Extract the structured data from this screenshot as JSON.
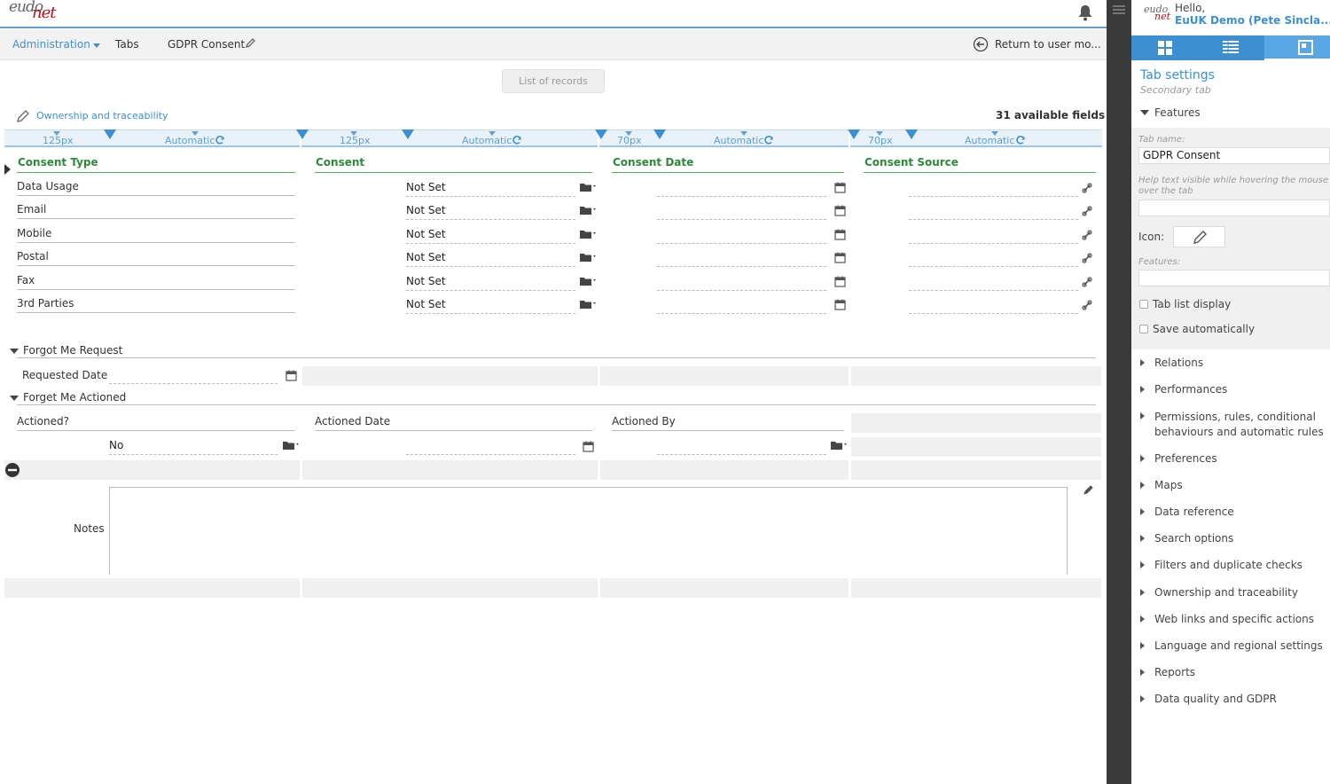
{
  "logo": {
    "line1": "eudo",
    "line2": "net"
  },
  "nav": {
    "administration": "Administration",
    "tabs": "Tabs",
    "tab_title": "GDPR Consent",
    "return_label": "Return to user mo..."
  },
  "toolbar": {
    "list_of_records": "List of records",
    "ownership_link": "Ownership and traceability",
    "available_fields": "31 available fields"
  },
  "ruler": [
    {
      "width_label": "125px",
      "mode_label": "Automatic"
    },
    {
      "width_label": "125px",
      "mode_label": "Automatic"
    },
    {
      "width_label": "70px",
      "mode_label": "Automatic"
    },
    {
      "width_label": "70px",
      "mode_label": "Automatic"
    }
  ],
  "consent_table": {
    "headers": [
      "Consent Type",
      "Consent",
      "Consent Date",
      "Consent Source"
    ],
    "rows": [
      {
        "type": "Data Usage",
        "consent": "Not Set"
      },
      {
        "type": "Email",
        "consent": "Not Set"
      },
      {
        "type": "Mobile",
        "consent": "Not Set"
      },
      {
        "type": "Postal",
        "consent": "Not Set"
      },
      {
        "type": "Fax",
        "consent": "Not Set"
      },
      {
        "type": "3rd Parties",
        "consent": "Not Set"
      }
    ]
  },
  "forgot_section": {
    "title": "Forgot Me Request",
    "requested_date_label": "Requested Date"
  },
  "actioned_section": {
    "title": "Forget Me Actioned",
    "actioned_label": "Actioned?",
    "actioned_value": "No",
    "actioned_date_label": "Actioned Date",
    "actioned_by_label": "Actioned By"
  },
  "notes": {
    "label": "Notes"
  },
  "user": {
    "greeting": "Hello,",
    "name": "EuUK Demo (Pete Sincla..."
  },
  "right_panel": {
    "title": "Tab settings",
    "subtitle": "Secondary tab",
    "features_header": "Features",
    "tab_name_label": "Tab name:",
    "tab_name_value": "GDPR Consent",
    "help_text_label": "Help text visible while hovering the mouse over the tab",
    "icon_label": "Icon:",
    "features_label": "Features:",
    "tab_list_display": "Tab list display",
    "save_automatically": "Save automatically",
    "sections": [
      "Relations",
      "Performances",
      "Permissions, rules, conditional behaviours and automatic rules",
      "Preferences",
      "Maps",
      "Data reference",
      "Search options",
      "Filters and duplicate checks",
      "Ownership and traceability",
      "Web links and specific actions",
      "Language and regional settings",
      "Reports",
      "Data quality and GDPR"
    ]
  },
  "colors": {
    "accent": "#3c8fd0",
    "header_green": "#2d8a3a",
    "splitter": "#3a3a3a"
  }
}
